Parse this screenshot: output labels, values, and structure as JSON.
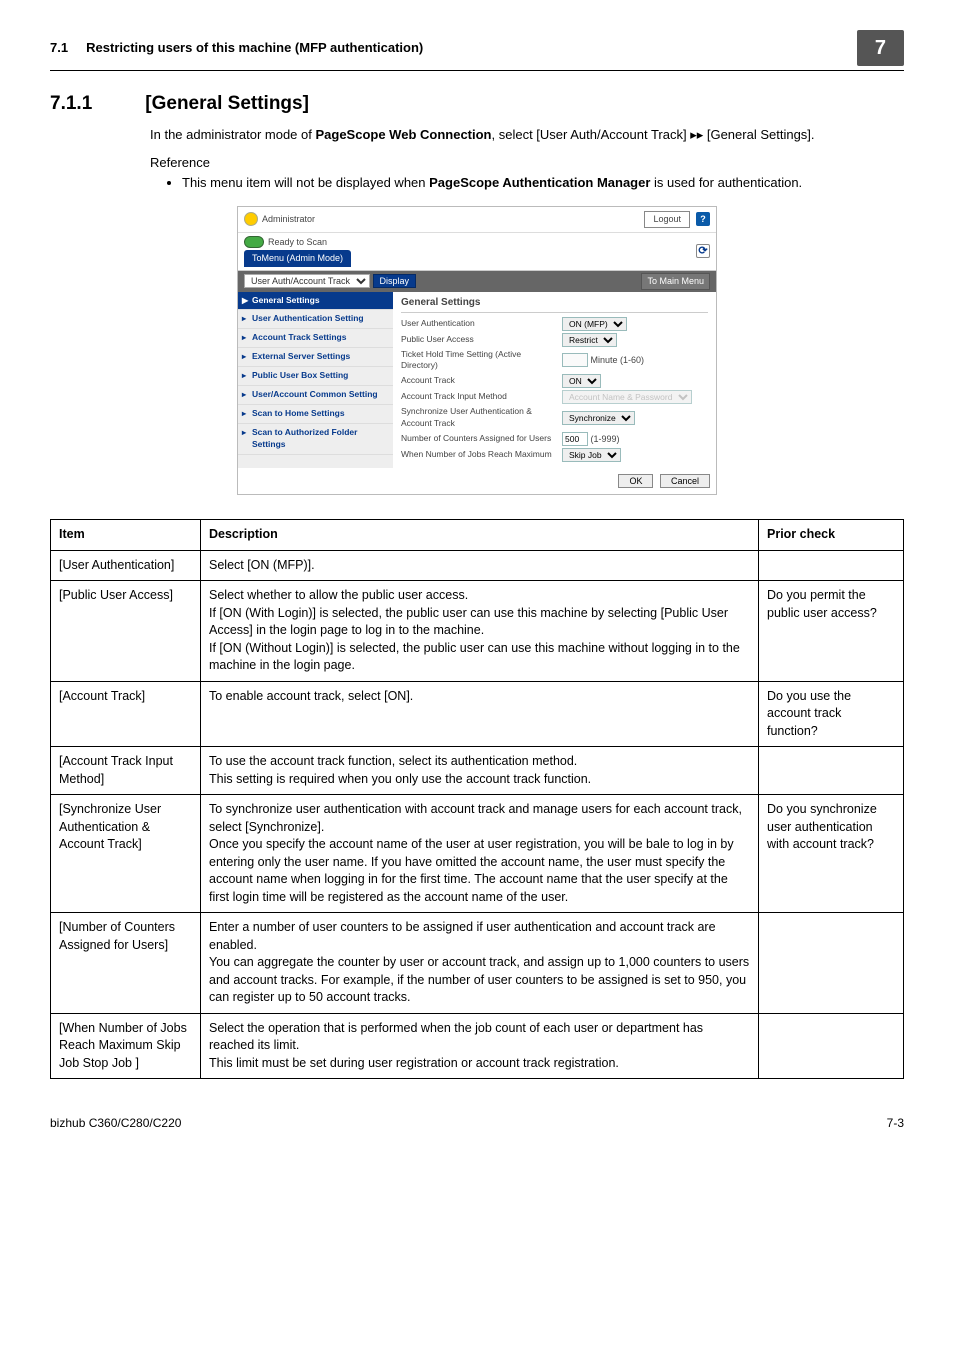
{
  "header": {
    "section_no": "7.1",
    "section_title": "Restricting users of this machine (MFP authentication)",
    "chapter_badge": "7"
  },
  "heading": {
    "num": "7.1.1",
    "title": "[General Settings]"
  },
  "intro_parts": {
    "p1": "In the administrator mode of ",
    "bold1": "PageScope Web Connection",
    "p2": ", select [User Auth/Account Track] ▸▸ [General Settings].",
    "ref_label": "Reference",
    "bullet1a": "This menu item will not be displayed when ",
    "bullet1b": "PageScope Authentication Manager",
    "bullet1c": " is used for authentication."
  },
  "ws": {
    "admin": "Administrator",
    "logout": "Logout",
    "ready": "Ready to Scan",
    "toMenu": "ToMenu (Admin Mode)",
    "category": "User Auth/Account Track",
    "display": "Display",
    "mainmenu": "To Main Menu",
    "side": [
      "General Settings",
      "User Authentication Setting",
      "Account Track Settings",
      "External Server Settings",
      "Public User Box Setting",
      "User/Account Common Setting",
      "Scan to Home Settings",
      "Scan to Authorized Folder Settings"
    ],
    "panelTitle": "General Settings",
    "rows": {
      "userAuth": {
        "label": "User Authentication",
        "val": "ON (MFP)"
      },
      "publicAccess": {
        "label": "Public User Access",
        "val": "Restrict"
      },
      "ticket": {
        "label": "Ticket Hold Time Setting (Active Directory)",
        "val": "",
        "suffix": "Minute (1-60)"
      },
      "acct": {
        "label": "Account Track",
        "val": "ON"
      },
      "acctInput": {
        "label": "Account Track Input Method",
        "val": "Account Name & Password"
      },
      "sync": {
        "label": "Synchronize User Authentication & Account Track",
        "val": "Synchronize"
      },
      "counters": {
        "label": "Number of Counters Assigned for Users",
        "val": "500",
        "suffix": "(1-999)"
      },
      "maxjobs": {
        "label": "When Number of Jobs Reach Maximum",
        "val": "Skip Job"
      }
    },
    "ok": "OK",
    "cancel": "Cancel"
  },
  "table": {
    "headers": {
      "item": "Item",
      "desc": "Description",
      "check": "Prior check"
    },
    "rows": [
      {
        "item": "[User Authentication]",
        "desc": "Select [ON (MFP)].",
        "check": ""
      },
      {
        "item": "[Public User Access]",
        "desc": "Select whether to allow the public user access.\nIf [ON (With Login)] is selected, the public user can use this machine by selecting [Public User Access] in the login page to log in to the machine.\nIf [ON (Without Login)] is selected, the public user can use this machine without logging in to the machine in the login page.",
        "check": "Do you permit the public user access?"
      },
      {
        "item": "[Account Track]",
        "desc": "To enable account track, select [ON].",
        "check": "Do you use the account track function?"
      },
      {
        "item": "[Account Track Input Method]",
        "desc": "To use the account track function, select its authentication method.\nThis setting is required when you only use the account track function.",
        "check": ""
      },
      {
        "item": "[Synchronize User Authentication & Account Track]",
        "desc": "To synchronize user authentication with account track and manage users for each account track, select [Synchronize].\nOnce you specify the account name of the user at user registration, you will be bale to log in by entering only the user name. If you have omitted the account name, the user must specify the account name when logging in for the first time. The account name that the user specify at the first login time will be registered as the account name of the user.",
        "check": "Do you synchronize user authentication with account track?"
      },
      {
        "item": "[Number of Counters Assigned for Users]",
        "desc": "Enter a number of user counters to be assigned if user authentication and account track are enabled.\nYou can aggregate the counter by user or account track, and assign up to 1,000 counters to users and account tracks. For example, if the number of user counters to be assigned is set to 950, you can register up to 50 account tracks.",
        "check": ""
      },
      {
        "item": "[When Number of Jobs Reach Maximum Skip Job Stop Job ]",
        "desc": "Select the operation that is performed when the job count of each user or department has reached its limit.\nThis limit must be set during user registration or account track registration.",
        "check": ""
      }
    ]
  },
  "footer": {
    "left": "bizhub C360/C280/C220",
    "right": "7-3"
  }
}
